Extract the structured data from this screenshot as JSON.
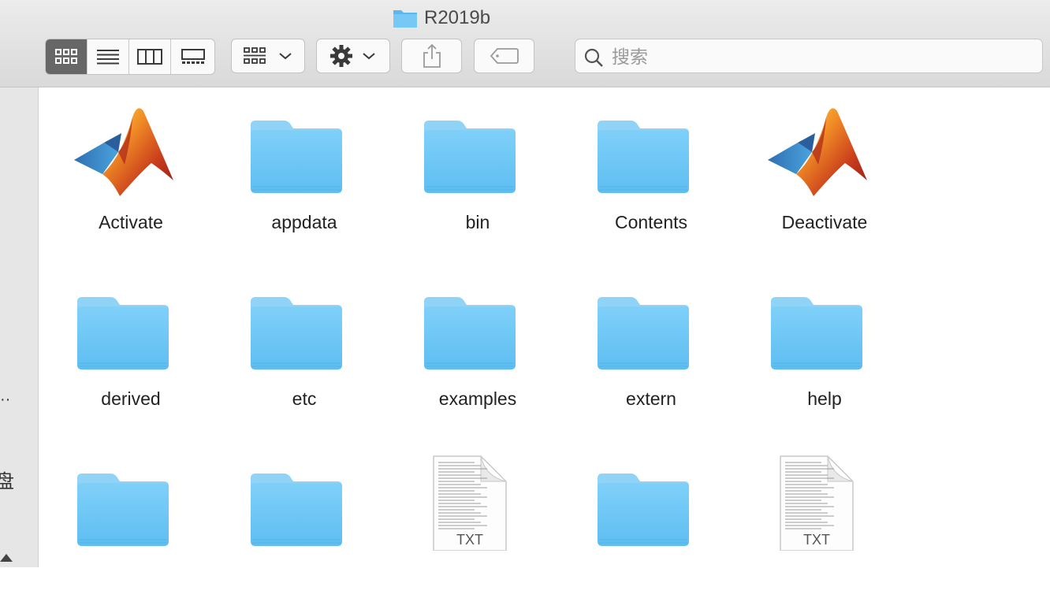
{
  "window": {
    "title": "R2019b"
  },
  "toolbar": {
    "view_modes": [
      {
        "name": "icon-view",
        "active": true
      },
      {
        "name": "list-view",
        "active": false
      },
      {
        "name": "column-view",
        "active": false
      },
      {
        "name": "gallery-view",
        "active": false
      }
    ],
    "buttons": [
      "group-by-menu",
      "action-gear-menu",
      "share-button",
      "tags-button"
    ]
  },
  "search": {
    "placeholder": "搜索"
  },
  "sidebar": {
    "fragment_1": "··",
    "fragment_2": "盘"
  },
  "items": [
    {
      "name": "Activate",
      "type": "matlab-app"
    },
    {
      "name": "appdata",
      "type": "folder"
    },
    {
      "name": "bin",
      "type": "folder"
    },
    {
      "name": "Contents",
      "type": "folder"
    },
    {
      "name": "Deactivate",
      "type": "matlab-app"
    },
    {
      "name": "derived",
      "type": "folder"
    },
    {
      "name": "etc",
      "type": "folder"
    },
    {
      "name": "examples",
      "type": "folder"
    },
    {
      "name": "extern",
      "type": "folder"
    },
    {
      "name": "help",
      "type": "folder"
    },
    {
      "name": "",
      "type": "folder"
    },
    {
      "name": "",
      "type": "folder"
    },
    {
      "name": "",
      "type": "txt",
      "badge": "TXT"
    },
    {
      "name": "",
      "type": "folder"
    },
    {
      "name": "",
      "type": "txt",
      "badge": "TXT"
    }
  ],
  "colors": {
    "folder": "#6ec6f5",
    "folder_tab": "#8fd3f7",
    "toolbar_bg": "#e3e3e3",
    "active_view": "#676767"
  }
}
